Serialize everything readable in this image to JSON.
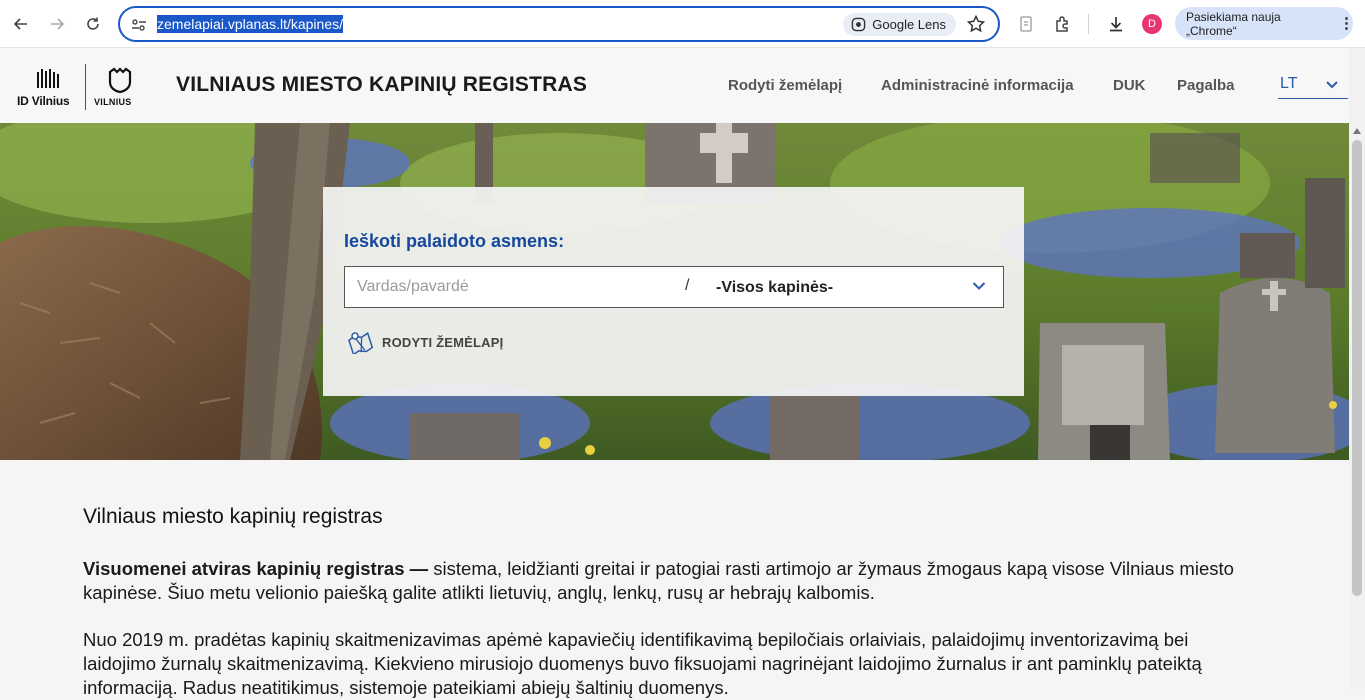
{
  "browser": {
    "url": "zemelapiai.vplanas.lt/kapines/",
    "lens_label": "Google Lens",
    "avatar_letter": "D",
    "update_label": "Pasiekiama nauja „Chrome“"
  },
  "header": {
    "logo_id_text": "ID Vilnius",
    "logo_city_text": "VILNIUS",
    "title": "VILNIAUS MIESTO KAPINIŲ REGISTRAS",
    "nav": [
      {
        "label": "Rodyti žemėlapį"
      },
      {
        "label": "Administracinė informacija"
      },
      {
        "label": "DUK"
      },
      {
        "label": "Pagalba"
      }
    ],
    "language": "LT"
  },
  "search": {
    "heading": "Ieškoti palaidoto asmens:",
    "name_placeholder": "Vardas/pavardė",
    "separator": "/",
    "cemetery_selected": "-Visos kapinės-",
    "map_link_label": "RODYTI ŽEMĖLAPĮ"
  },
  "content": {
    "heading": "Vilniaus miesto kapinių registras",
    "para1_bold": "Visuomenei atviras kapinių registras —",
    "para1_rest": " sistema, leidžianti greitai ir patogiai rasti artimojo ar žymaus žmogaus kapą visose Vilniaus miesto kapinėse. Šiuo metu velionio paiešką galite atlikti lietuvių, anglų, lenkų, rusų ar hebrajų kalbomis.",
    "para2": "Nuo 2019 m. pradėtas kapinių skaitmenizavimas apėmė kapaviečių identifikavimą bepiločiais orlaiviais, palaidojimų inventorizavimą bei laidojimo žurnalų skaitmenizavimą. Kiekvieno mirusiojo duomenys buvo fiksuojami nagrinėjant laidojimo žurnalus ir ant paminklų pateiktą informaciją. Radus neatitikimus, sistemoje pateikiami abiejų šaltinių duomenys."
  },
  "colors": {
    "accent_blue": "#17479e",
    "omnibox_border": "#1a57c8"
  }
}
